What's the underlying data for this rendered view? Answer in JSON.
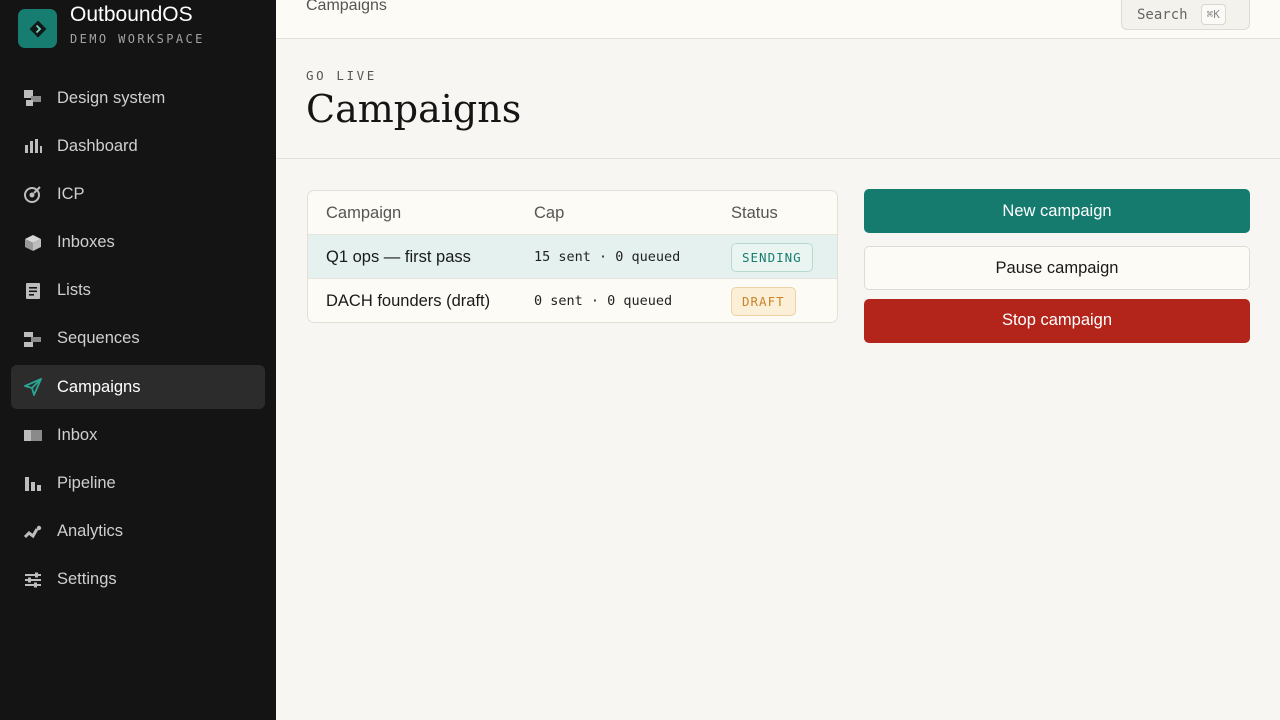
{
  "brand": {
    "name": "OutboundOS",
    "workspace": "DEMO WORKSPACE",
    "accent": "#177d70"
  },
  "sidebar": {
    "items": [
      {
        "label": "Design system",
        "icon": "design-system-icon"
      },
      {
        "label": "Dashboard",
        "icon": "bar-chart-icon"
      },
      {
        "label": "ICP",
        "icon": "target-icon"
      },
      {
        "label": "Inboxes",
        "icon": "box-icon"
      },
      {
        "label": "Lists",
        "icon": "document-list-icon"
      },
      {
        "label": "Sequences",
        "icon": "sequence-icon"
      },
      {
        "label": "Campaigns",
        "icon": "send-icon",
        "active": true
      },
      {
        "label": "Inbox",
        "icon": "inbox-icon"
      },
      {
        "label": "Pipeline",
        "icon": "pipeline-icon"
      },
      {
        "label": "Analytics",
        "icon": "analytics-icon"
      },
      {
        "label": "Settings",
        "icon": "sliders-icon"
      }
    ]
  },
  "topbar": {
    "breadcrumb": "Campaigns",
    "search_label": "Search",
    "search_shortcut": "⌘K"
  },
  "header": {
    "eyebrow": "GO LIVE",
    "title": "Campaigns"
  },
  "table": {
    "columns": [
      "Campaign",
      "Cap",
      "Status"
    ],
    "rows": [
      {
        "name": "Q1 ops — first pass",
        "cap": "15 sent · 0 queued",
        "status": "SENDING",
        "status_color": "#177d70",
        "selected": true
      },
      {
        "name": "DACH founders (draft)",
        "cap": "0 sent · 0 queued",
        "status": "DRAFT",
        "status_color": "#c98427",
        "selected": false
      }
    ]
  },
  "actions": {
    "new_label": "New campaign",
    "pause_label": "Pause campaign",
    "stop_label": "Stop campaign",
    "primary_color": "#167b6f",
    "danger_color": "#b3251a"
  }
}
